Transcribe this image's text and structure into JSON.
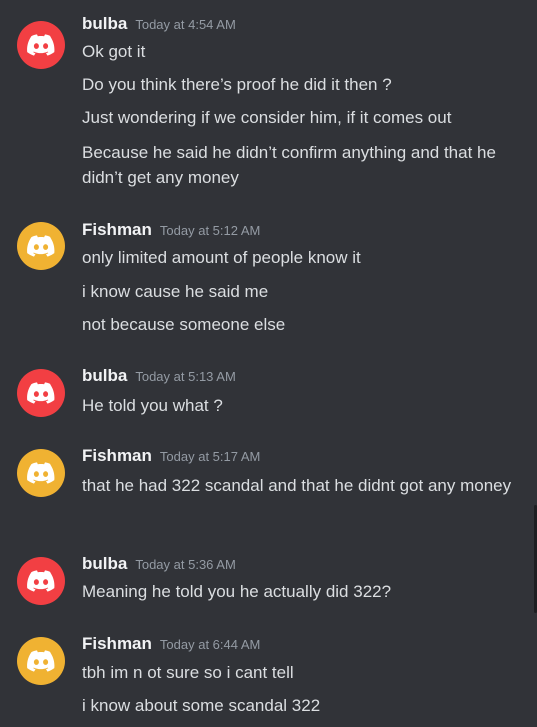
{
  "colors": {
    "background": "#313338",
    "avatar_red": "#f23f43",
    "avatar_yellow": "#f0b232",
    "username": "#f2f3f5",
    "timestamp": "#949ba4",
    "message_text": "#dbdee1"
  },
  "messages": [
    {
      "author": "bulba",
      "avatar_icon": "discord-logo-icon",
      "timestamp": "Today at 4:54 AM",
      "lines": [
        "Ok got it",
        "Do you think there’s proof he did it then ?",
        "Just wondering if we consider him, if it comes out",
        "Because he said he didn’t confirm anything and that he didn’t get any money"
      ]
    },
    {
      "author": "Fishman",
      "avatar_icon": "discord-logo-icon",
      "timestamp": "Today at 5:12 AM",
      "lines": [
        "only limited amount of people know it",
        "i know cause he said me",
        "not because someone else"
      ]
    },
    {
      "author": "bulba",
      "avatar_icon": "discord-logo-icon",
      "timestamp": "Today at 5:13 AM",
      "lines": [
        "He told you what ?"
      ]
    },
    {
      "author": "Fishman",
      "avatar_icon": "discord-logo-icon",
      "timestamp": "Today at 5:17 AM",
      "lines": [
        "that he had 322 scandal and that he didnt got any money"
      ]
    },
    {
      "author": "bulba",
      "avatar_icon": "discord-logo-icon",
      "timestamp": "Today at 5:36 AM",
      "lines": [
        "Meaning he told you he actually did 322?"
      ]
    },
    {
      "author": "Fishman",
      "avatar_icon": "discord-logo-icon",
      "timestamp": "Today at 6:44 AM",
      "lines": [
        "tbh im n ot sure so i cant tell",
        "i know about some scandal 322"
      ]
    }
  ]
}
